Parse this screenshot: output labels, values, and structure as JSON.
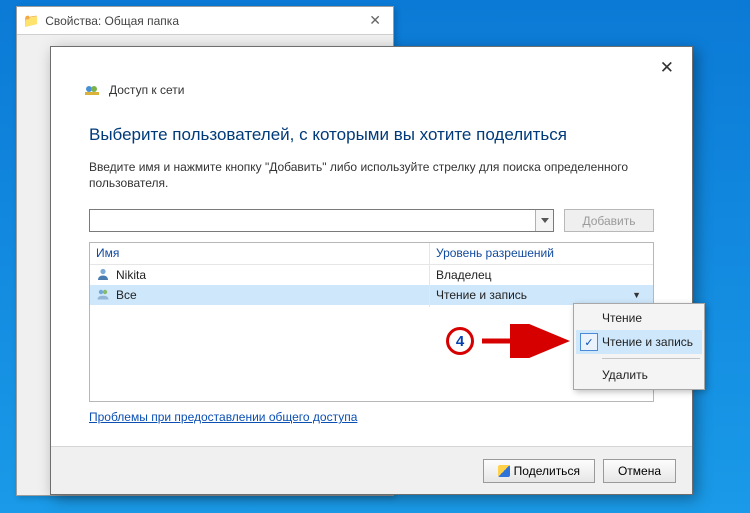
{
  "props_window": {
    "title": "Свойства: Общая папка"
  },
  "wizard": {
    "header_text": "Доступ к сети",
    "heading": "Выберите пользователей, с которыми вы хотите поделиться",
    "instructions": "Введите имя и нажмите кнопку \"Добавить\" либо используйте стрелку для поиска определенного пользователя.",
    "user_input_value": "",
    "add_button": "Добавить",
    "table": {
      "col_name": "Имя",
      "col_level": "Уровень разрешений",
      "rows": [
        {
          "icon": "user",
          "name": "Nikita",
          "level": "Владелец",
          "selected": false
        },
        {
          "icon": "group",
          "name": "Все",
          "level": "Чтение и запись",
          "selected": true
        }
      ]
    },
    "problems_link": "Проблемы при предоставлении общего доступа",
    "footer": {
      "share": "Поделиться",
      "cancel": "Отмена"
    }
  },
  "context_menu": {
    "items": [
      {
        "label": "Чтение",
        "checked": false,
        "hovered": false
      },
      {
        "label": "Чтение и запись",
        "checked": true,
        "hovered": true
      }
    ],
    "separator_then": {
      "label": "Удалить"
    }
  },
  "annotation": {
    "step_number": "4"
  }
}
